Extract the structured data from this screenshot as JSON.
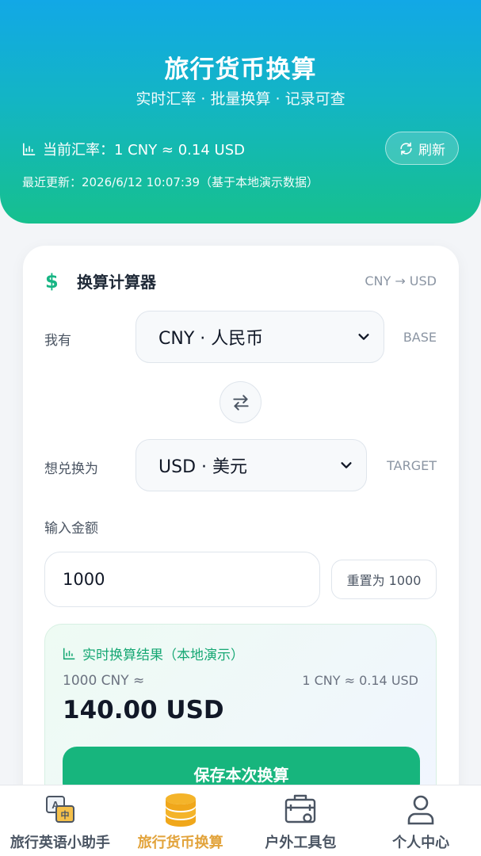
{
  "header": {
    "title": "旅行货币换算",
    "subtitle": "实时汇率 · 批量换算 · 记录可查",
    "rate_text": "当前汇率：1 CNY ≈ 0.14 USD",
    "refresh_label": "刷新",
    "update_text": "最近更新：2026/6/12 10:07:39（基于本地演示数据）"
  },
  "calculator": {
    "title": "换算计算器",
    "pair_label": "CNY → USD",
    "from_label": "我有",
    "from_value": "CNY · 人民币",
    "from_tag": "BASE",
    "to_label": "想兑换为",
    "to_value": "USD · 美元",
    "to_tag": "TARGET",
    "amount_label": "输入金额",
    "amount_value": "1000",
    "reset_label": "重置为 1000"
  },
  "result": {
    "title": "实时换算结果（本地演示）",
    "left_text": "1000 CNY ≈",
    "right_text": "1 CNY ≈ 0.14 USD",
    "value": "140.00 USD",
    "save_label": "保存本次换算"
  },
  "tabbar": {
    "items": [
      {
        "label": "旅行英语小助手",
        "icon": "translate-icon"
      },
      {
        "label": "旅行货币换算",
        "icon": "coins-icon"
      },
      {
        "label": "户外工具包",
        "icon": "toolbox-icon"
      },
      {
        "label": "个人中心",
        "icon": "person-icon"
      }
    ],
    "active_index": 1
  },
  "colors": {
    "header_gradient_top": "#12a8e6",
    "header_gradient_bottom": "#16c08e",
    "accent_green": "#17b57d",
    "active_tab": "#e2a33b"
  }
}
